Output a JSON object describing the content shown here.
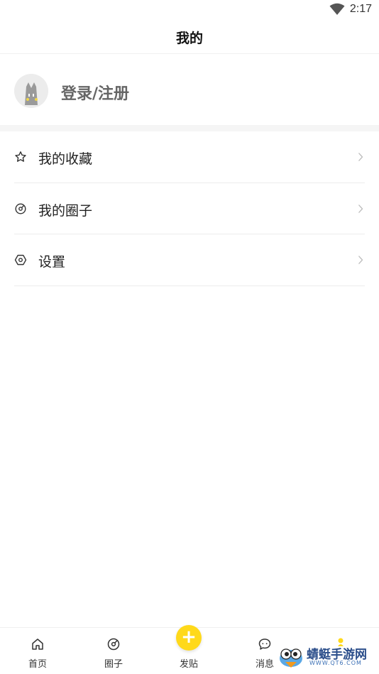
{
  "status_bar": {
    "time": "2:17"
  },
  "header": {
    "title": "我的"
  },
  "profile": {
    "login_label": "登录/注册"
  },
  "menu": {
    "items": [
      {
        "label": "我的收藏",
        "icon": "star-icon"
      },
      {
        "label": "我的圈子",
        "icon": "circle-icon"
      },
      {
        "label": "设置",
        "icon": "settings-icon"
      }
    ]
  },
  "tab_bar": {
    "tabs": [
      {
        "label": "首页",
        "icon": "home-icon"
      },
      {
        "label": "圈子",
        "icon": "circle-icon"
      },
      {
        "label": "发贴",
        "icon": "plus-icon"
      },
      {
        "label": "消息",
        "icon": "chat-icon"
      },
      {
        "label": "",
        "icon": "profile-icon"
      }
    ],
    "accent_color": "#FFD91A"
  },
  "watermark": {
    "text": "蜻蜓手游网",
    "sub": "WWW.QT6.COM"
  }
}
